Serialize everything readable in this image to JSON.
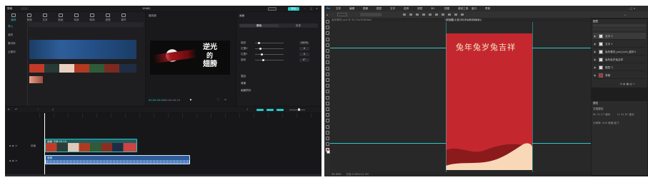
{
  "editor": {
    "app_name": "剪映",
    "title": "19462",
    "export_label": "导出",
    "toolbar": [
      "媒体",
      "音频",
      "文本",
      "贴纸",
      "特效",
      "转场",
      "滤镜",
      "调节"
    ],
    "sidebar": [
      "导入",
      "我的",
      "素材库",
      "云素材"
    ],
    "player_label": "播放器",
    "preview_text": [
      "逆光",
      "的",
      "翅膀"
    ],
    "timecode": "00:00:00:00",
    "duration": "00:00:03:10",
    "panel_title": "画面",
    "panel_tabs": [
      "基础",
      "抠像"
    ],
    "props": [
      {
        "name": "缩放",
        "value": "100%"
      },
      {
        "name": "位置X",
        "value": "0"
      },
      {
        "name": "位置Y",
        "value": "0"
      },
      {
        "name": "旋转",
        "value": "0°"
      }
    ],
    "panel_sections": [
      "混合",
      "背景",
      "画面防抖"
    ],
    "track_clip_label": "画面 中间 03:10",
    "audio_clip_label": "音频",
    "track_tag": "封面",
    "accent": "#27c8c8",
    "clip_color": "#1f5f5f",
    "audio_color": "#3a7bd5"
  },
  "ps": {
    "menu": [
      "文件",
      "编辑",
      "图像",
      "图层",
      "文字",
      "选择",
      "滤镜",
      "3D",
      "视图",
      "增效工具",
      "窗口",
      "帮助"
    ],
    "tabs": [
      "兔年素材.psd @ 33.3%(RGB/8#)",
      "未标题-1 @ 33.3%(RGB/8#)"
    ],
    "canvas_title": "兔年兔岁兔吉祥",
    "layers_panel_title": "图层",
    "layers": [
      "文字 2",
      "文字 1",
      "兔年素材_psd_lock_副本3",
      "兔年兔岁兔吉祥",
      "图层 3",
      "背景"
    ],
    "props_title": "属性",
    "props_lines": [
      "文档属性",
      "W: 21.17 厘米",
      "H: 31.67 厘米",
      "分辨率: 300 像素/英寸"
    ],
    "status": "33.33%",
    "status_info": "文档:6.08M/23.3M",
    "canvas_red": "#c4282e",
    "canvas_dark": "#8b1a1c",
    "canvas_light": "#f8d8b8",
    "guide": "#2ec8c8"
  }
}
